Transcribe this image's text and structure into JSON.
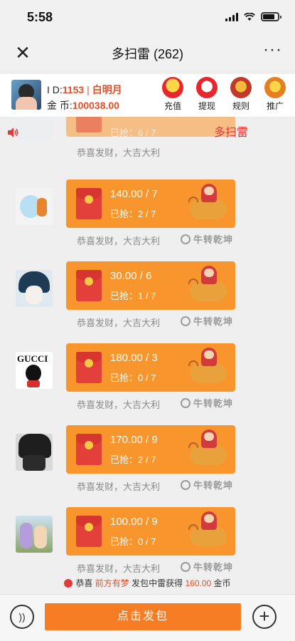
{
  "status_bar": {
    "time": "5:58",
    "battery_level": 0.8
  },
  "nav": {
    "title": "多扫雷 (262)",
    "close_icon": "close-icon",
    "more_icon": "more-icon",
    "more": "···"
  },
  "user": {
    "id_label": "I D:",
    "id_value": "1153",
    "separator": "|",
    "name": "白明月",
    "coins_label": "金 币:",
    "coins_value": "100038.00"
  },
  "actions": [
    {
      "label": "充值",
      "icon": "recharge-icon"
    },
    {
      "label": "提现",
      "icon": "withdraw-icon"
    },
    {
      "label": "规则",
      "icon": "rules-icon"
    },
    {
      "label": "推广",
      "icon": "promote-icon"
    }
  ],
  "game_tag": "多扫雷",
  "partial_message": {
    "grabbed": "已抢：6 / 7",
    "blessing": "恭喜发财，大吉大利"
  },
  "messages": [
    {
      "amount": "140.00 / 7",
      "grabbed": "已抢：2 / 7",
      "blessing": "恭喜发财，大吉大利",
      "brand": "牛转乾坤"
    },
    {
      "amount": "30.00 / 6",
      "grabbed": "已抢：1 / 7",
      "blessing": "恭喜发财，大吉大利",
      "brand": "牛转乾坤"
    },
    {
      "amount": "180.00 / 3",
      "grabbed": "已抢：0 / 7",
      "blessing": "恭喜发财，大吉大利",
      "brand": "牛转乾坤",
      "avatar_text": "GUCCI"
    },
    {
      "amount": "170.00 / 9",
      "grabbed": "已抢：2 / 7",
      "blessing": "恭喜发财，大吉大利",
      "brand": "牛转乾坤"
    },
    {
      "amount": "100.00 / 9",
      "grabbed": "已抢：0 / 7",
      "blessing": "恭喜发财，大吉大利",
      "brand": "牛转乾坤"
    }
  ],
  "notice": {
    "prefix": "恭喜",
    "who": "前方有梦",
    "middle": "发包中雷获得",
    "value": "160.00",
    "suffix": "金币"
  },
  "bottom": {
    "send_label": "点击发包",
    "plus": "+",
    "voice": "))"
  }
}
